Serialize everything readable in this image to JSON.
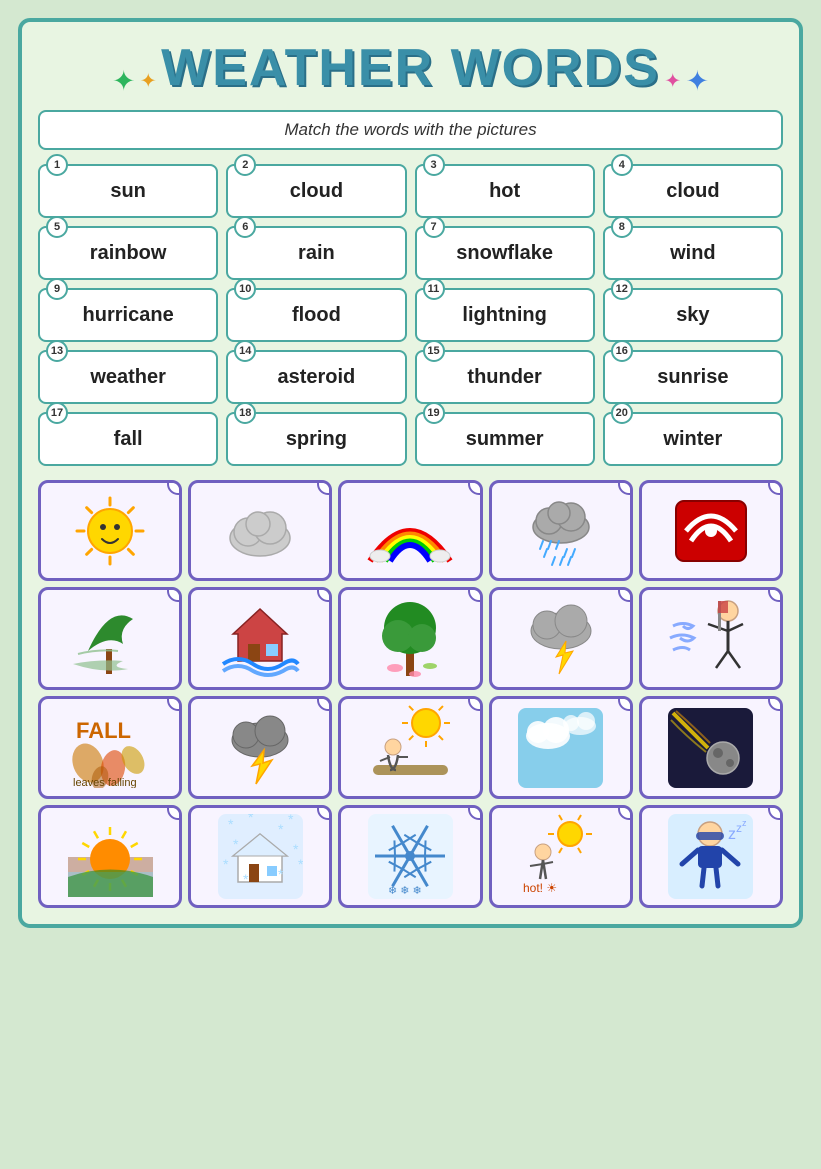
{
  "title": "WEATHER WORDS",
  "instructions": "Match  the words with the pictures",
  "words": [
    {
      "num": 1,
      "word": "sun"
    },
    {
      "num": 2,
      "word": "cloud"
    },
    {
      "num": 3,
      "word": "hot"
    },
    {
      "num": 4,
      "word": "cloud"
    },
    {
      "num": 5,
      "word": "rainbow"
    },
    {
      "num": 6,
      "word": "rain"
    },
    {
      "num": 7,
      "word": "snowflake"
    },
    {
      "num": 8,
      "word": "wind"
    },
    {
      "num": 9,
      "word": "hurricane"
    },
    {
      "num": 10,
      "word": "flood"
    },
    {
      "num": 11,
      "word": "lightning"
    },
    {
      "num": 12,
      "word": "sky"
    },
    {
      "num": 13,
      "word": "weather"
    },
    {
      "num": 14,
      "word": "asteroid"
    },
    {
      "num": 15,
      "word": "thunder"
    },
    {
      "num": 16,
      "word": "sunrise"
    },
    {
      "num": 17,
      "word": "fall"
    },
    {
      "num": 18,
      "word": "spring"
    },
    {
      "num": 19,
      "word": "summer"
    },
    {
      "num": 20,
      "word": "winter"
    }
  ],
  "pictures": [
    {
      "desc": "sun smiley",
      "icon": "☀️"
    },
    {
      "desc": "cloud grey",
      "icon": "☁️"
    },
    {
      "desc": "rainbow",
      "icon": "🌈"
    },
    {
      "desc": "rain cloud",
      "icon": "🌧️"
    },
    {
      "desc": "hurricane sign",
      "icon": "🌀"
    },
    {
      "desc": "wind trees",
      "icon": "🌬️"
    },
    {
      "desc": "flood house",
      "icon": "🌊"
    },
    {
      "desc": "spring tree",
      "icon": "🌳"
    },
    {
      "desc": "lightning cloud",
      "icon": "⛈️"
    },
    {
      "desc": "wind person",
      "icon": "💨"
    },
    {
      "desc": "fall leaves",
      "icon": "🍂"
    },
    {
      "desc": "thunder cloud",
      "icon": "🌩️"
    },
    {
      "desc": "summer relax",
      "icon": "🏖️"
    },
    {
      "desc": "sky blue",
      "icon": "🌤️"
    },
    {
      "desc": "asteroid",
      "icon": "☄️"
    },
    {
      "desc": "sunrise",
      "icon": "🌅"
    },
    {
      "desc": "winter snow",
      "icon": "❄️"
    },
    {
      "desc": "snowflake",
      "icon": "❄️"
    },
    {
      "desc": "hot sun person",
      "icon": "🌞"
    },
    {
      "desc": "winter person",
      "icon": "🥶"
    }
  ]
}
